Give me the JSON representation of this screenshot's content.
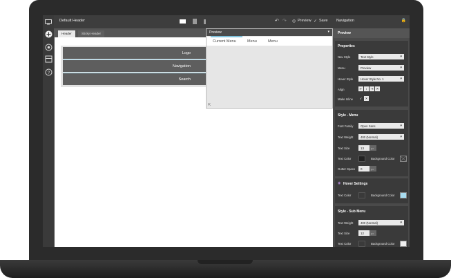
{
  "app": {
    "title": "Default Header"
  },
  "toolbar": {
    "preview_label": "Preview",
    "save_label": "Save"
  },
  "tabs": [
    {
      "label": "Header"
    },
    {
      "label": "Sticky Header"
    }
  ],
  "header_rows": [
    {
      "label": "Logo"
    },
    {
      "label": "Navigation"
    },
    {
      "label": "Search"
    }
  ],
  "preview": {
    "title": "Preview",
    "menu": [
      "Current Menu",
      "Menu",
      "Menu"
    ]
  },
  "panel": {
    "title": "Navigation",
    "preview_label": "Preview",
    "properties": {
      "title": "Properties",
      "nav_style_label": "Nav Style",
      "nav_style_value": "Text Style",
      "menu_label": "Menu",
      "menu_value": "Preview",
      "hover_style_label": "Hover Style",
      "hover_style_value": "Hover Style No. 1",
      "align_label": "Align",
      "make_inline_label": "Make Inline"
    },
    "style_menu": {
      "title": "Style - Menu",
      "font_family_label": "Font Family",
      "font_family_value": "Open Sans",
      "text_weight_label": "Text Weight",
      "text_weight_value": "400 (Normal)",
      "text_size_label": "Text Size",
      "text_size_value": "13",
      "text_size_unit": "px",
      "text_color_label": "Text Color",
      "bg_color_label": "Background Color",
      "gutter_label": "Gutter Space",
      "gutter_value": "0",
      "gutter_unit": "px"
    },
    "hover_settings": {
      "title": "Hover Settings",
      "text_color_label": "Text Color",
      "bg_color_label": "Background Color"
    },
    "style_submenu": {
      "title": "Style - Sub Menu",
      "text_weight_label": "Text Weight",
      "text_weight_value": "400 (Normal)",
      "text_size_label": "Text Size",
      "text_size_value": "12",
      "text_size_unit": "px",
      "text_color_label": "Text Color",
      "bg_color_label": "Background Color"
    }
  },
  "colors": {
    "accent": "#7fc2dc",
    "menu_text_color": "#222222",
    "hover_text_color": "#3a3a3a",
    "hover_bg_color": "#a8dcf0",
    "submenu_text_color": "#3a3a3a",
    "submenu_bg_color": "#f0f0f0"
  }
}
